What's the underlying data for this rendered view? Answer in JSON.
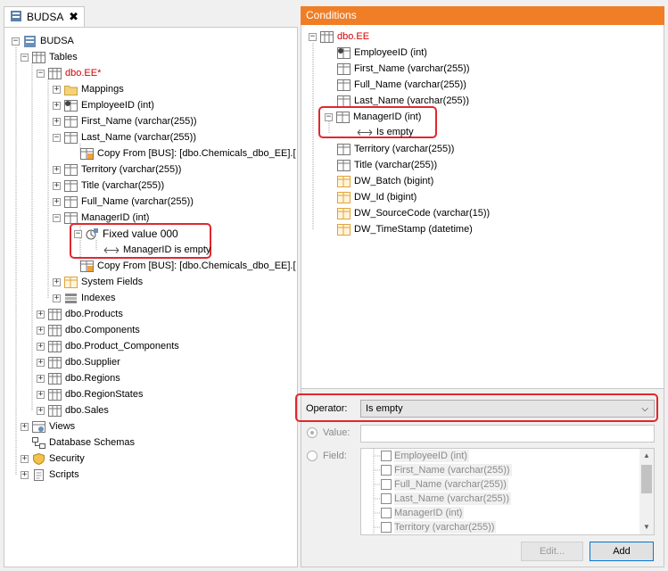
{
  "doc_tab": {
    "title": "BUDSA",
    "close": "✖"
  },
  "left_tree": {
    "root": "BUDSA",
    "tables": "Tables",
    "ee_table": "dbo.EE*",
    "mappings": "Mappings",
    "employee_id": "EmployeeID (int)",
    "first_name": "First_Name (varchar(255))",
    "last_name": "Last_Name (varchar(255))",
    "copy_from_1": "Copy From [BUS]: [dbo.Chemicals_dbo_EE].[",
    "territory": "Territory (varchar(255))",
    "title": "Title (varchar(255))",
    "full_name": "Full_Name (varchar(255))",
    "manager_id": "ManagerID (int)",
    "fixed_value": "Fixed value 000",
    "manager_empty": "ManagerID is empty",
    "copy_from_2": "Copy From [BUS]: [dbo.Chemicals_dbo_EE].[",
    "system_fields": "System Fields",
    "indexes": "Indexes",
    "tables_list": [
      "dbo.Products",
      "dbo.Components",
      "dbo.Product_Components",
      "dbo.Supplier",
      "dbo.Regions",
      "dbo.RegionStates",
      "dbo.Sales"
    ],
    "views": "Views",
    "db_schemas": "Database Schemas",
    "security": "Security",
    "scripts": "Scripts"
  },
  "conditions": {
    "header": "Conditions",
    "table": "dbo.EE",
    "fields": [
      "EmployeeID (int)",
      "First_Name (varchar(255))",
      "Full_Name (varchar(255))",
      "Last_Name (varchar(255))"
    ],
    "manager_id": "ManagerID (int)",
    "is_empty": "Is empty",
    "fields_after": [
      "Territory (varchar(255))",
      "Title (varchar(255))"
    ],
    "dw_fields": [
      "DW_Batch (bigint)",
      "DW_Id (bigint)",
      "DW_SourceCode (varchar(15))",
      "DW_TimeStamp (datetime)"
    ]
  },
  "form": {
    "operator_label": "Operator:",
    "operator_value": "Is empty",
    "value_label": "Value:",
    "field_label": "Field:",
    "field_items": [
      "EmployeeID (int)",
      "First_Name (varchar(255))",
      "Full_Name (varchar(255))",
      "Last_Name (varchar(255))",
      "ManagerID (int)",
      "Territory (varchar(255))"
    ],
    "edit_label": "Edit...",
    "add_label": "Add"
  },
  "colors": {
    "accent": "#f07e26",
    "highlight": "#e0282e",
    "modified": "#d40000"
  }
}
